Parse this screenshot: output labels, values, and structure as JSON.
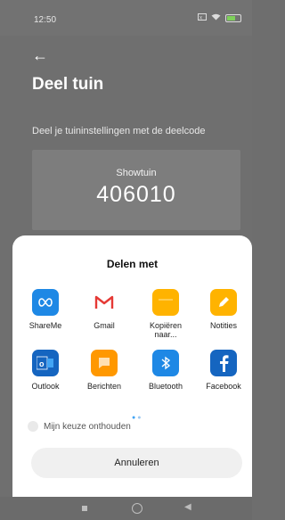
{
  "status": {
    "time": "12:50",
    "icons": [
      "sim-icon",
      "wifi-icon",
      "battery-icon"
    ]
  },
  "page": {
    "title": "Deel tuin",
    "description": "Deel je tuininstellingen met de deelcode",
    "code_name": "Showtuin",
    "code_value": "406010"
  },
  "sheet": {
    "title": "Delen met",
    "apps": [
      {
        "label": "ShareMe",
        "icon": "shareme-icon",
        "color": "#1e88e5"
      },
      {
        "label": "Gmail",
        "icon": "gmail-icon",
        "color": "#ffffff"
      },
      {
        "label": "Kopiëren\nnaar...",
        "icon": "copy-to-icon",
        "color": "#ffb300"
      },
      {
        "label": "Notities",
        "icon": "notes-icon",
        "color": "#ffb300"
      },
      {
        "label": "Outlook",
        "icon": "outlook-icon",
        "color": "#1565c0"
      },
      {
        "label": "Berichten",
        "icon": "messages-icon",
        "color": "#ff9800"
      },
      {
        "label": "Bluetooth",
        "icon": "bluetooth-icon",
        "color": "#1e88e5"
      },
      {
        "label": "Facebook",
        "icon": "facebook-icon",
        "color": "#1565c0"
      }
    ],
    "remember_label": "Mijn keuze onthouden",
    "cancel_label": "Annuleren"
  },
  "colors": {
    "accent": "#42a5f5"
  }
}
